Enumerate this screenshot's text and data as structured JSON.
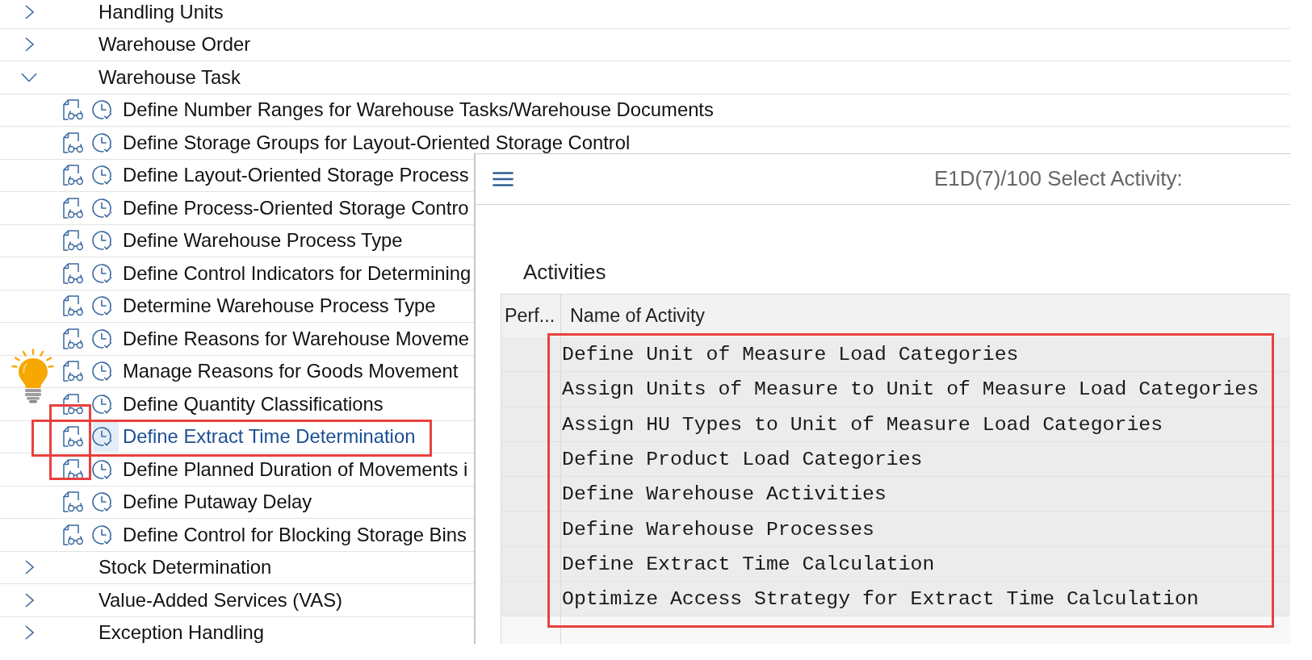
{
  "tree": {
    "items": [
      {
        "label": "Handling Units",
        "expanded": false
      },
      {
        "label": "Warehouse Order",
        "expanded": false
      },
      {
        "label": "Warehouse Task",
        "expanded": true,
        "children": [
          {
            "label": "Define Number Ranges for Warehouse Tasks/Warehouse Documents",
            "selected": false,
            "marked": false
          },
          {
            "label": "Define Storage Groups for Layout-Oriented Storage Control",
            "selected": false,
            "marked": false
          },
          {
            "label": "Define Layout-Oriented Storage Process",
            "selected": false,
            "marked": false
          },
          {
            "label": "Define Process-Oriented Storage Contro",
            "selected": false,
            "marked": false
          },
          {
            "label": "Define Warehouse Process Type",
            "selected": false,
            "marked": false
          },
          {
            "label": "Define Control Indicators for Determining",
            "selected": false,
            "marked": false
          },
          {
            "label": "Determine Warehouse Process Type",
            "selected": false,
            "marked": false
          },
          {
            "label": "Define Reasons for Warehouse Moveme",
            "selected": false,
            "marked": false
          },
          {
            "label": "Manage Reasons for Goods Movement",
            "selected": false,
            "marked": false
          },
          {
            "label": "Define Quantity Classifications",
            "selected": false,
            "marked": false
          },
          {
            "label": "Define Extract Time Determination",
            "selected": true,
            "marked": true
          },
          {
            "label": "Define Planned Duration of Movements i",
            "selected": false,
            "marked": false
          },
          {
            "label": "Define Putaway Delay",
            "selected": false,
            "marked": false
          },
          {
            "label": "Define Control for Blocking Storage Bins",
            "selected": false,
            "marked": false
          }
        ]
      },
      {
        "label": "Stock Determination",
        "expanded": false
      },
      {
        "label": "Value-Added Services (VAS)",
        "expanded": false
      },
      {
        "label": "Exception Handling",
        "expanded": false
      }
    ]
  },
  "dialog": {
    "title": "E1D(7)/100 Select Activity:",
    "section_title": "Activities",
    "table": {
      "columns": [
        "Perf...",
        "Name of Activity"
      ],
      "marked": true,
      "rows": [
        "Define Unit of Measure Load Categories",
        "Assign Units of Measure to Unit of Measure Load Categories",
        "Assign HU Types to Unit of Measure Load Categories",
        "Define Product Load Categories",
        "Define Warehouse Activities",
        "Define Warehouse Processes",
        "Define Extract Time Calculation",
        "Optimize Access Strategy for Extract Time Calculation"
      ]
    }
  }
}
